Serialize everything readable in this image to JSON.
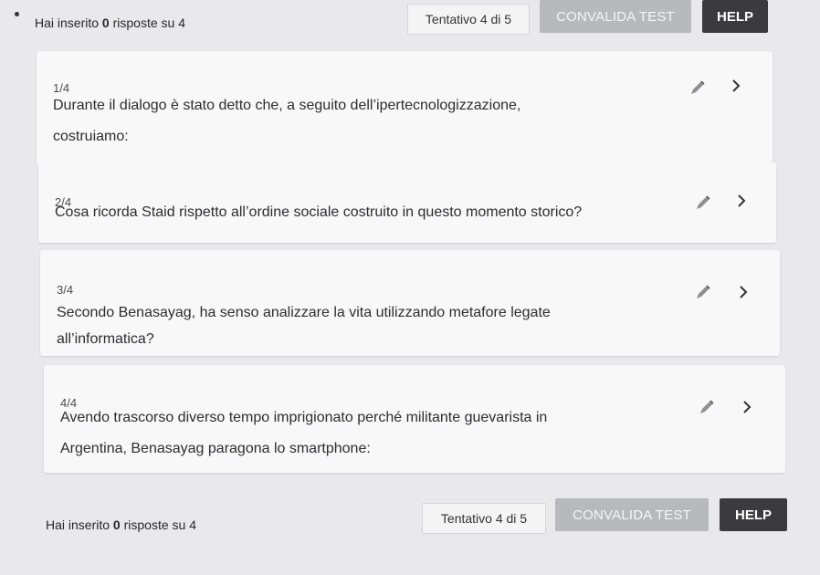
{
  "status": {
    "prefix": "Hai inserito",
    "answered": "0",
    "suffix": "risposte su 4"
  },
  "attempt_label": "Tentativo 4 di 5",
  "validate_label": "CONVALIDA TEST",
  "help_label": "HELP",
  "questions": [
    {
      "number": "1/4",
      "line1": "Durante il dialogo è stato detto che, a seguito dell’ipertecnologizzazione,",
      "line2": "costruiamo:"
    },
    {
      "number": "2/4",
      "line1": "Cosa ricorda Staid rispetto all’ordine sociale costruito in questo momento storico?",
      "line2": ""
    },
    {
      "number": "3/4",
      "line1": "Secondo Benasayag, ha senso analizzare la vita utilizzando metafore legate",
      "line2": "all’informatica?"
    },
    {
      "number": "4/4",
      "line1": "Avendo trascorso diverso tempo imprigionato perché militante guevarista in",
      "line2": "Argentina, Benasayag paragona lo smartphone:"
    }
  ],
  "icons": {
    "edit": "pencil-icon",
    "open": "chevron-right-icon"
  },
  "colors": {
    "background": "#e9e9eb",
    "card": "#f8f8f9",
    "validate_button": "#b8b9bd",
    "help_button": "#3b3b3f"
  }
}
